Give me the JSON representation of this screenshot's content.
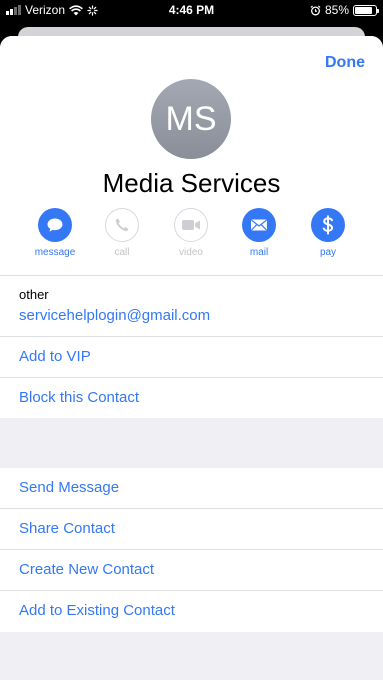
{
  "status_bar": {
    "carrier": "Verizon",
    "time": "4:46 PM",
    "battery_percent": "85%",
    "battery_level": 0.85
  },
  "header": {
    "done_label": "Done",
    "avatar_initials": "MS",
    "contact_name": "Media Services"
  },
  "actions": [
    {
      "label": "message",
      "icon": "message-bubble-icon",
      "enabled": true
    },
    {
      "label": "call",
      "icon": "phone-icon",
      "enabled": false
    },
    {
      "label": "video",
      "icon": "video-camera-icon",
      "enabled": false
    },
    {
      "label": "mail",
      "icon": "envelope-icon",
      "enabled": true
    },
    {
      "label": "pay",
      "icon": "dollar-icon",
      "enabled": true
    }
  ],
  "email": {
    "label": "other",
    "value": "servicehelplogin@gmail.com"
  },
  "group1_rows": [
    "Add to VIP",
    "Block this Contact"
  ],
  "group2_rows": [
    "Send Message",
    "Share Contact",
    "Create New Contact",
    "Add to Existing Contact"
  ],
  "colors": {
    "accent": "#3478f6",
    "background": "#efeff4",
    "avatar": "#9a9ea8"
  }
}
